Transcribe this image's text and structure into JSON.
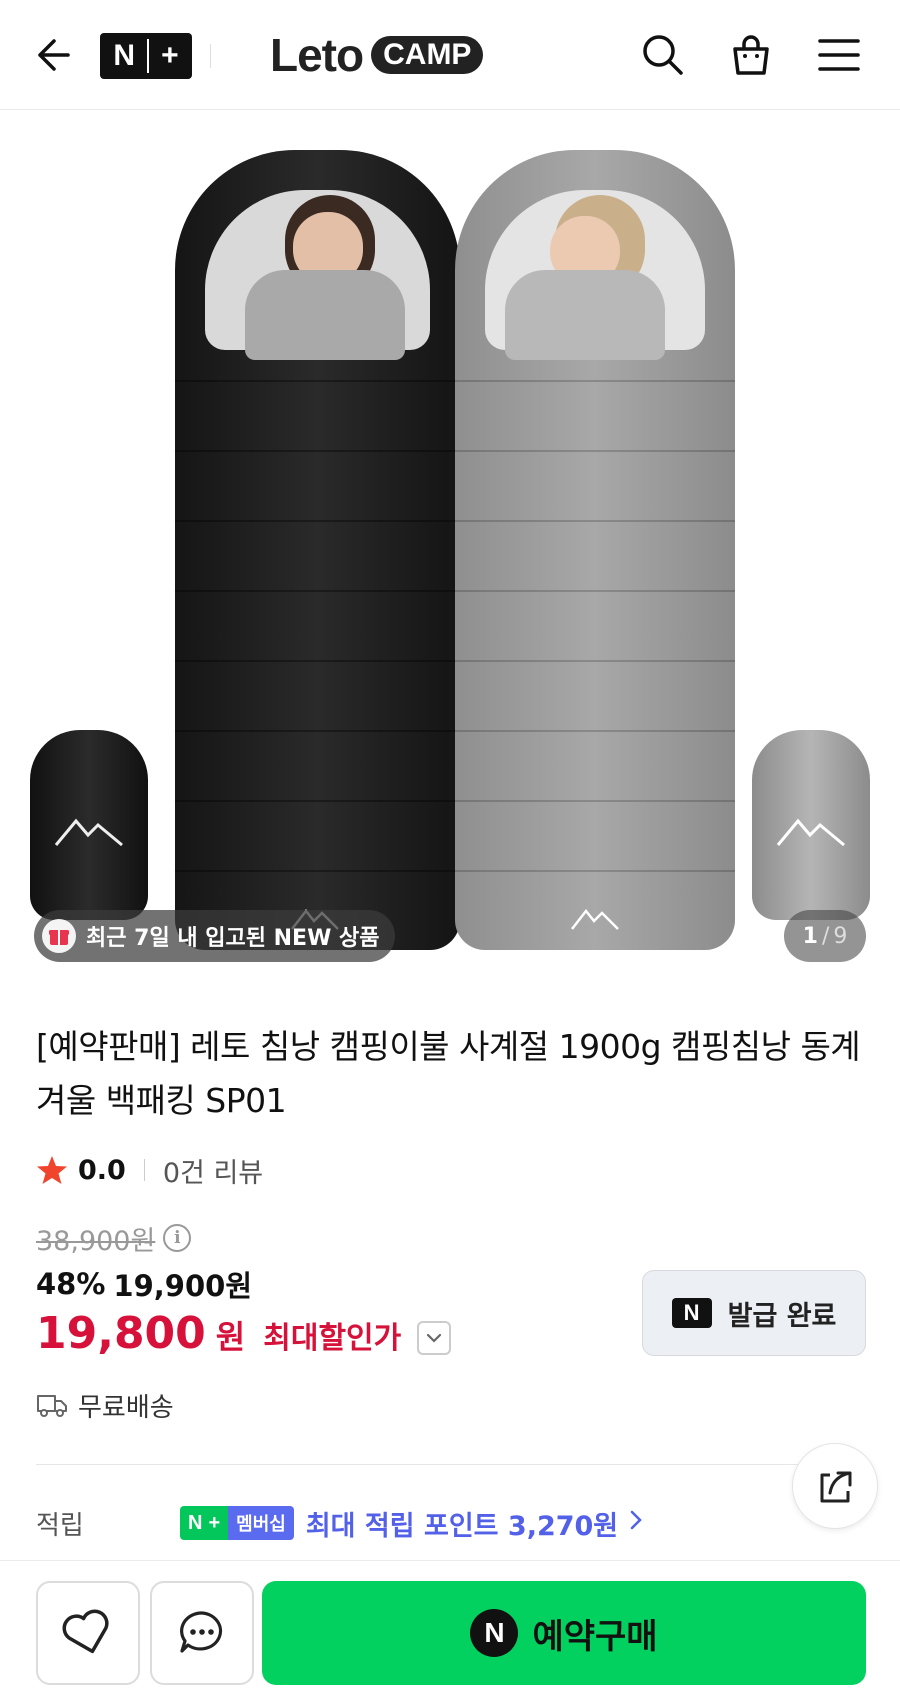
{
  "header": {
    "nplus_n": "N",
    "nplus_plus": "+",
    "logo_leto": "Leto",
    "logo_camp": "CAMP",
    "icons": [
      "back-arrow-icon",
      "search-icon",
      "shopping-bag-icon",
      "hamburger-menu-icon"
    ]
  },
  "gallery": {
    "badge_text": "최근 7일 내 입고된 NEW 상품",
    "page_current": "1",
    "page_sep": "/",
    "page_total": "9",
    "colors": [
      "#1a1a1a",
      "#9e9e9e"
    ]
  },
  "product": {
    "title": "[예약판매] 레토 침낭 캠핑이불 사계절 1900g 캠핑침낭 동계 겨울 백패킹 SP01",
    "rating": {
      "score": "0.0",
      "reviews": "0건 리뷰"
    },
    "original_price": "38,900원",
    "discount_rate": "48%",
    "sale_price": "19,900원",
    "best_price": "19,800",
    "best_price_unit": "원",
    "best_price_label": "최대할인가",
    "coupon_n": "N",
    "coupon_label": "발급 완료",
    "shipping": "무료배송",
    "accent_color": "#d6113a"
  },
  "points": {
    "label": "적립",
    "badge_n": "N",
    "badge_plus": "+",
    "badge_member": "멤버십",
    "text": "최대 적립 포인트 3,270원",
    "color": "#5361e8"
  },
  "bottom_bar": {
    "buy_n": "N",
    "buy_label": "예약구매",
    "buy_color": "#03d15f"
  }
}
